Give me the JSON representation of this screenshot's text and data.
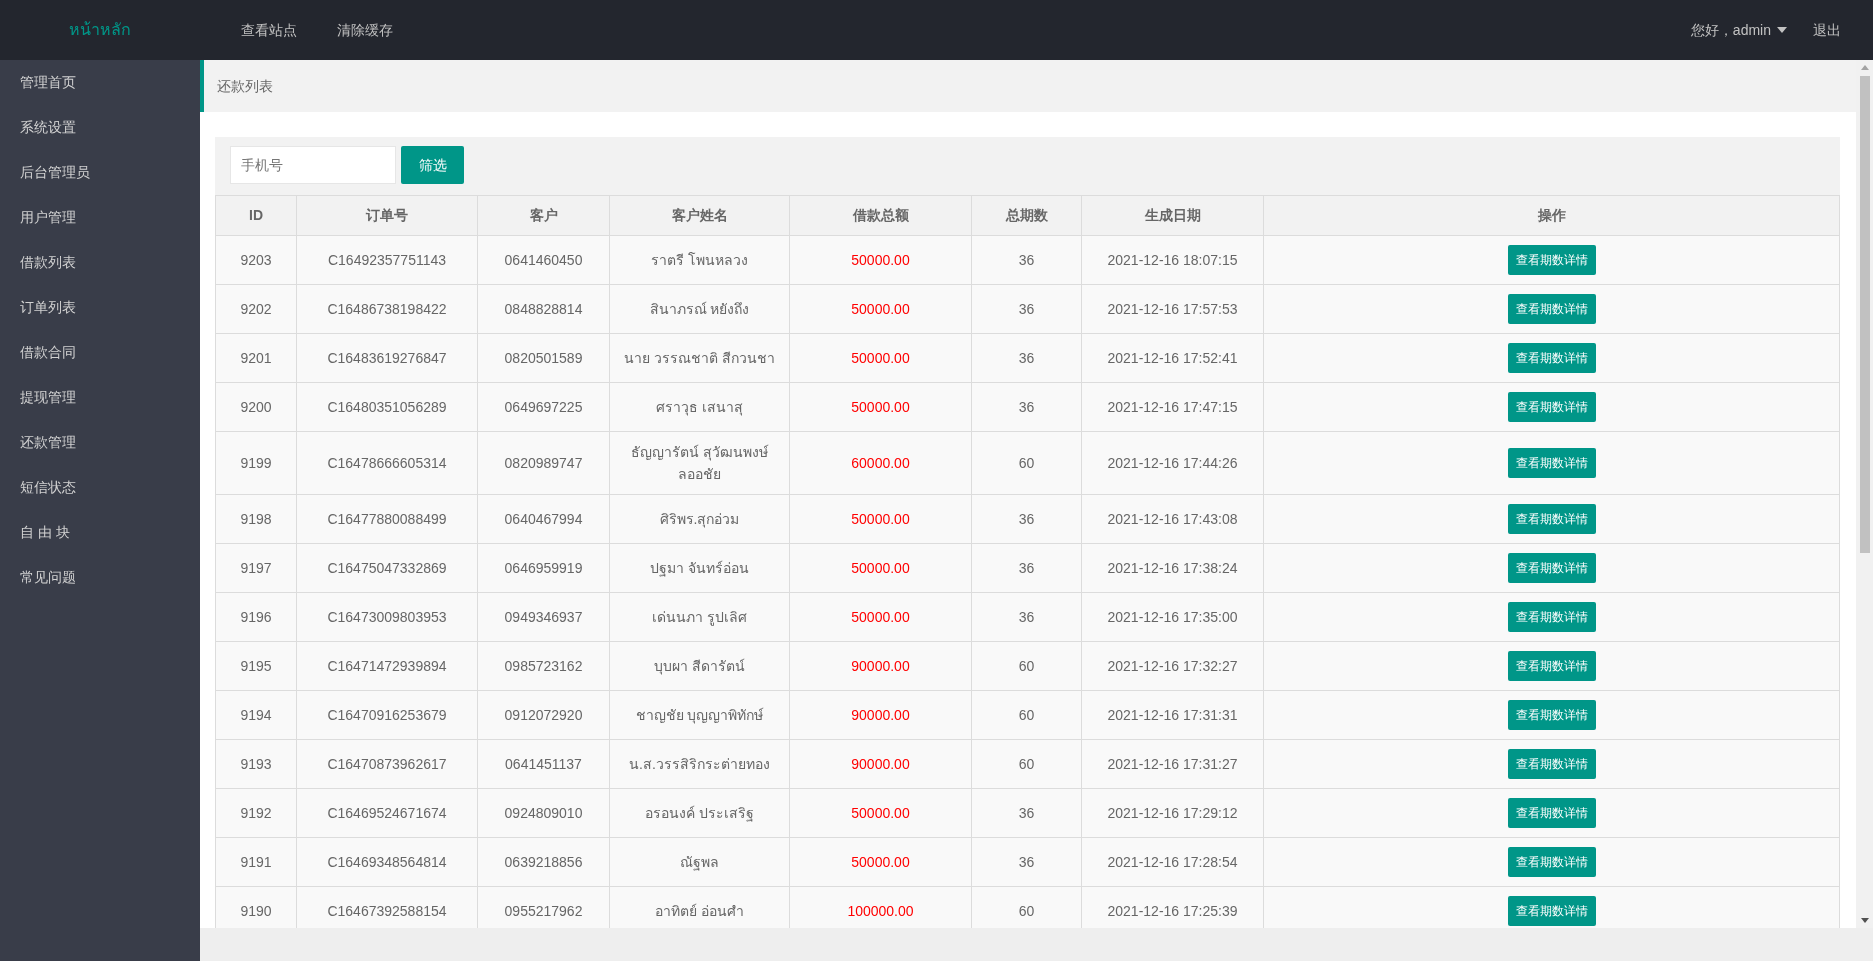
{
  "header": {
    "logo": "หน้าหลัก",
    "nav": [
      "查看站点",
      "清除缓存"
    ],
    "user": "您好，admin",
    "logout": "退出"
  },
  "sidebar": {
    "items": [
      "管理首页",
      "系统设置",
      "后台管理员",
      "用户管理",
      "借款列表",
      "订单列表",
      "借款合同",
      "提现管理",
      "还款管理",
      "短信状态",
      "自 由 块",
      "常见问题"
    ]
  },
  "breadcrumb": {
    "title": "还款列表"
  },
  "filter": {
    "placeholder": "手机号",
    "button": "筛选"
  },
  "table": {
    "columns": [
      "ID",
      "订单号",
      "客户",
      "客户姓名",
      "借款总额",
      "总期数",
      "生成日期",
      "操作"
    ],
    "rows": [
      {
        "id": "9203",
        "order_no": "C16492357751143",
        "customer": "0641460450",
        "name": "ราตรี โพนหลวง",
        "amount": "50000.00",
        "periods": "36",
        "created": "2021-12-16 18:07:15",
        "action": "查看期数详情"
      },
      {
        "id": "9202",
        "order_no": "C16486738198422",
        "customer": "0848828814",
        "name": "สินาภรณ์ หยังถึง",
        "amount": "50000.00",
        "periods": "36",
        "created": "2021-12-16 17:57:53",
        "action": "查看期数详情"
      },
      {
        "id": "9201",
        "order_no": "C16483619276847",
        "customer": "0820501589",
        "name": "นาย วรรณชาติ สีกวนชา",
        "amount": "50000.00",
        "periods": "36",
        "created": "2021-12-16 17:52:41",
        "action": "查看期数详情"
      },
      {
        "id": "9200",
        "order_no": "C16480351056289",
        "customer": "0649697225",
        "name": "ศราวุธ เสนาสุ",
        "amount": "50000.00",
        "periods": "36",
        "created": "2021-12-16 17:47:15",
        "action": "查看期数详情"
      },
      {
        "id": "9199",
        "order_no": "C16478666605314",
        "customer": "0820989747",
        "name": "ธัญญารัตน์ สุวัฒนพงษ์ลออชัย",
        "amount": "60000.00",
        "periods": "60",
        "created": "2021-12-16 17:44:26",
        "action": "查看期数详情"
      },
      {
        "id": "9198",
        "order_no": "C16477880088499",
        "customer": "0640467994",
        "name": "ศิริพร.สุกอ่วม",
        "amount": "50000.00",
        "periods": "36",
        "created": "2021-12-16 17:43:08",
        "action": "查看期数详情"
      },
      {
        "id": "9197",
        "order_no": "C16475047332869",
        "customer": "0646959919",
        "name": "ปฐมา จันทร์อ่อน",
        "amount": "50000.00",
        "periods": "36",
        "created": "2021-12-16 17:38:24",
        "action": "查看期数详情"
      },
      {
        "id": "9196",
        "order_no": "C16473009803953",
        "customer": "0949346937",
        "name": "เด่นนภา รูปเลิศ",
        "amount": "50000.00",
        "periods": "36",
        "created": "2021-12-16 17:35:00",
        "action": "查看期数详情"
      },
      {
        "id": "9195",
        "order_no": "C16471472939894",
        "customer": "0985723162",
        "name": "บุบผา สีดารัตน์",
        "amount": "90000.00",
        "periods": "60",
        "created": "2021-12-16 17:32:27",
        "action": "查看期数详情"
      },
      {
        "id": "9194",
        "order_no": "C16470916253679",
        "customer": "0912072920",
        "name": "ชาญชัย บุญญาพิทักษ์",
        "amount": "90000.00",
        "periods": "60",
        "created": "2021-12-16 17:31:31",
        "action": "查看期数详情"
      },
      {
        "id": "9193",
        "order_no": "C16470873962617",
        "customer": "0641451137",
        "name": "น.ส.วรรสิริกระต่ายทอง",
        "amount": "90000.00",
        "periods": "60",
        "created": "2021-12-16 17:31:27",
        "action": "查看期数详情"
      },
      {
        "id": "9192",
        "order_no": "C16469524671674",
        "customer": "0924809010",
        "name": "อรอนงค์ ประเสริฐ",
        "amount": "50000.00",
        "periods": "36",
        "created": "2021-12-16 17:29:12",
        "action": "查看期数详情"
      },
      {
        "id": "9191",
        "order_no": "C16469348564814",
        "customer": "0639218856",
        "name": "ณัฐพล",
        "amount": "50000.00",
        "periods": "36",
        "created": "2021-12-16 17:28:54",
        "action": "查看期数详情"
      },
      {
        "id": "9190",
        "order_no": "C16467392588154",
        "customer": "0955217962",
        "name": "อาทิตย์ อ่อนศำ",
        "amount": "100000.00",
        "periods": "60",
        "created": "2021-12-16 17:25:39",
        "action": "查看期数详情"
      }
    ]
  }
}
